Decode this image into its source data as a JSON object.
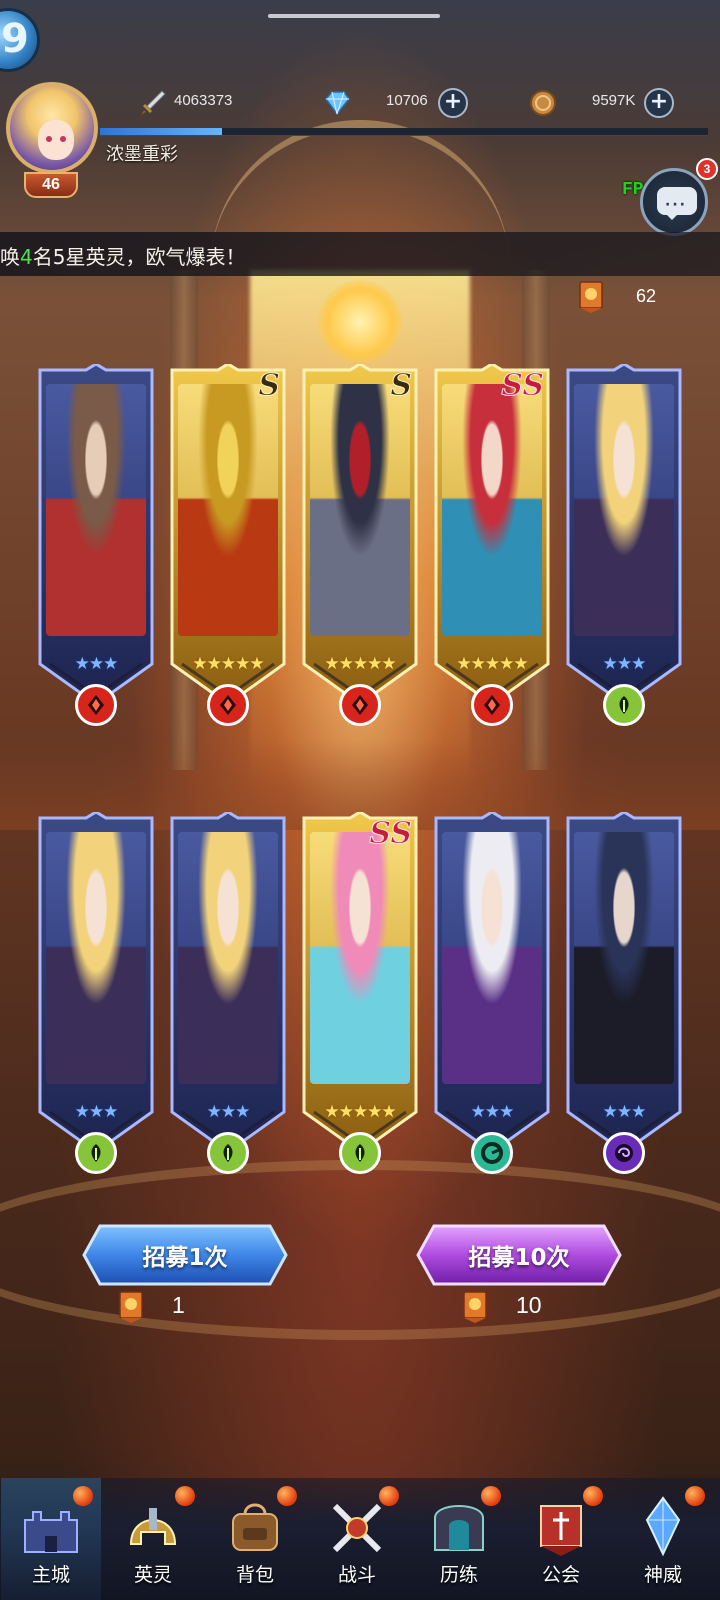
{
  "player": {
    "name": "浓墨重彩",
    "level": "46",
    "exp_fraction": 0.2
  },
  "corner_orb": "9",
  "resources": {
    "power": {
      "icon": "sword-icon",
      "value": "4063373"
    },
    "diamond": {
      "icon": "diamond-icon",
      "value": "10706"
    },
    "coin": {
      "icon": "coin-icon",
      "value": "9597K"
    }
  },
  "fps_text": "FPS: 50",
  "chat": {
    "icon": "chat-bubble-icon",
    "badge": "3"
  },
  "marquee": {
    "prefix": "唤",
    "highlight": "4",
    "suffix": "名5星英灵，欧气爆表！"
  },
  "ticket_count": {
    "icon": "summon-ticket-icon",
    "value": "62"
  },
  "cards": [
    {
      "rank": "",
      "stars": 3,
      "star_color": "blue",
      "frame": "blue",
      "element": "fire",
      "element_color": "#d8251c",
      "art_palette": [
        "#7a5a48",
        "#e7cdb7",
        "#b0312f"
      ]
    },
    {
      "rank": "S",
      "stars": 5,
      "star_color": "gold",
      "frame": "gold",
      "element": "fire",
      "element_color": "#d8251c",
      "art_palette": [
        "#c89a22",
        "#f2d35a",
        "#b93a12"
      ]
    },
    {
      "rank": "S",
      "stars": 5,
      "star_color": "gold",
      "frame": "gold",
      "element": "fire",
      "element_color": "#d8251c",
      "art_palette": [
        "#2f3246",
        "#b11f2b",
        "#6b6f86"
      ]
    },
    {
      "rank": "SS",
      "stars": 5,
      "star_color": "gold",
      "frame": "gold",
      "element": "fire",
      "element_color": "#d8251c",
      "art_palette": [
        "#c72f3c",
        "#f3d7c8",
        "#2f8fb4"
      ]
    },
    {
      "rank": "",
      "stars": 3,
      "star_color": "blue",
      "frame": "blue",
      "element": "nature",
      "element_color": "#86c43a",
      "art_palette": [
        "#f2d27a",
        "#f6e2d4",
        "#3b2f5a"
      ]
    },
    {
      "rank": "",
      "stars": 3,
      "star_color": "blue",
      "frame": "blue",
      "element": "nature",
      "element_color": "#86c43a",
      "art_palette": [
        "#f2d27a",
        "#f6e2d4",
        "#3b2f5a"
      ]
    },
    {
      "rank": "",
      "stars": 3,
      "star_color": "blue",
      "frame": "blue",
      "element": "nature",
      "element_color": "#86c43a",
      "art_palette": [
        "#f2d27a",
        "#f6e2d4",
        "#3b2f5a"
      ]
    },
    {
      "rank": "SS",
      "stars": 5,
      "star_color": "gold",
      "frame": "gold",
      "element": "nature",
      "element_color": "#86c43a",
      "art_palette": [
        "#f08ab8",
        "#f6e2d4",
        "#6fd0e0"
      ]
    },
    {
      "rank": "",
      "stars": 3,
      "star_color": "blue",
      "frame": "blue",
      "element": "wind",
      "element_color": "#2bb894",
      "art_palette": [
        "#ececf2",
        "#f6e2d4",
        "#5a2f86"
      ]
    },
    {
      "rank": "",
      "stars": 3,
      "star_color": "blue",
      "frame": "blue",
      "element": "dark",
      "element_color": "#6a2bb8",
      "art_palette": [
        "#2a3358",
        "#e6d6cc",
        "#1c1c28"
      ]
    }
  ],
  "pull": {
    "single": {
      "label": "招募1次",
      "cost": "1",
      "color": "#3f86e8"
    },
    "ten": {
      "label": "招募10次",
      "cost": "10",
      "color": "#b04be0"
    }
  },
  "nav": [
    {
      "key": "main-city",
      "label": "主城",
      "icon": "castle-icon",
      "active": true
    },
    {
      "key": "heroes",
      "label": "英灵",
      "icon": "helmet-icon",
      "active": false
    },
    {
      "key": "bag",
      "label": "背包",
      "icon": "backpack-icon",
      "active": false
    },
    {
      "key": "battle",
      "label": "战斗",
      "icon": "crossed-swords-icon",
      "active": false
    },
    {
      "key": "trials",
      "label": "历练",
      "icon": "gate-icon",
      "active": false
    },
    {
      "key": "guild",
      "label": "公会",
      "icon": "guild-banner-icon",
      "active": false
    },
    {
      "key": "divine",
      "label": "神威",
      "icon": "crystal-icon",
      "active": false
    }
  ]
}
